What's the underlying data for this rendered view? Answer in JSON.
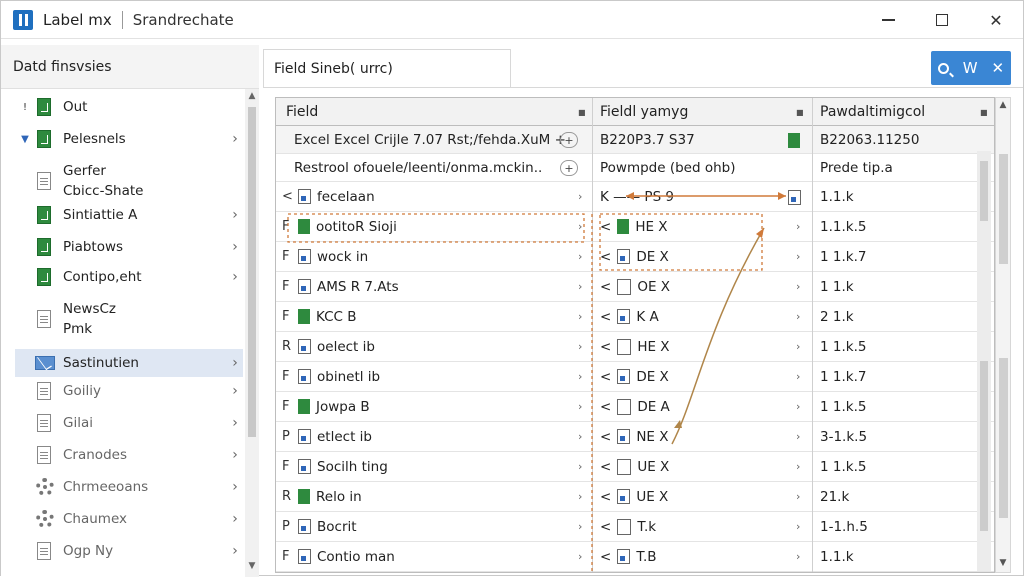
{
  "titlebar": {
    "app_name": "Label mx",
    "doc_name": "Srandrechate",
    "minimize": "—",
    "maximize": "☐",
    "close": "✕"
  },
  "sidebar": {
    "header": "Datd finsvsies",
    "items": [
      {
        "label": "Out",
        "icon": "excel-file-icon",
        "expander": "!"
      },
      {
        "label": "Pelesnels",
        "icon": "excel-file-icon",
        "expander": "▼"
      },
      {
        "label": "Gerfer\nCbicc-Shate",
        "icon": "document-icon",
        "expander": ""
      },
      {
        "label": "Sintiattie A",
        "icon": "excel-file-icon",
        "expander": ""
      },
      {
        "label": "Piabtows",
        "icon": "excel-file-icon",
        "expander": ""
      },
      {
        "label": "Contipo,eht",
        "icon": "excel-file-icon",
        "expander": ""
      },
      {
        "label": "NewsCz\nPmk",
        "icon": "document-icon",
        "expander": ""
      },
      {
        "label": "Sastinutien",
        "icon": "mail-icon",
        "expander": ""
      },
      {
        "label": "Goiliy",
        "icon": "chart-icon",
        "expander": ""
      },
      {
        "label": "Gilai",
        "icon": "puzzle-icon",
        "expander": ""
      },
      {
        "label": "Cranodes",
        "icon": "table-icon",
        "expander": ""
      },
      {
        "label": "Chrmeeoans",
        "icon": "gear-icon",
        "expander": ""
      },
      {
        "label": "Chaumex",
        "icon": "gear-icon",
        "expander": ""
      },
      {
        "label": "Ogp  Ny",
        "icon": "folder-icon",
        "expander": ""
      }
    ],
    "chevron": "›"
  },
  "tab": {
    "label": "Field Sineb( urrc)"
  },
  "search": {
    "letter": "W",
    "close": "✕"
  },
  "grid": {
    "columns": [
      "Field",
      "Fieldl yamyg",
      "Pawdaltimigcol"
    ],
    "rows": [
      {
        "pfx": "",
        "c1": "Excel Excel Crijle 7.07 Rst;/fehda.XuM +",
        "c2": "B220P3.7 S37",
        "c3": "B22063.11250",
        "plus": "+"
      },
      {
        "pfx": "",
        "c1": "Restrool ofouele/leenti/onma.mckin..",
        "c2": "Powmpde (bed ohb)",
        "c3": "Prede tip.a",
        "plus": "+"
      },
      {
        "pfx": "<",
        "c1": "fecelaan",
        "c2": "K  ——  PS 9",
        "c3": "1.1.k"
      },
      {
        "pfx": "F",
        "c1": "ootitoR Sioji",
        "c2": "HE X",
        "c3": "1.1.k.5",
        "lead": "<"
      },
      {
        "pfx": "F",
        "c1": "wock in",
        "c2": "DE X",
        "c3": "1 1.k.7",
        "lead": "<"
      },
      {
        "pfx": "F",
        "c1": "AMS R 7.Ats",
        "c2": "OE X",
        "c3": "1 1.k",
        "lead": "<"
      },
      {
        "pfx": "F",
        "c1": "KCC B",
        "c2": "K A",
        "c3": "2 1.k",
        "lead": "<"
      },
      {
        "pfx": "R",
        "c1": "oelect ib",
        "c2": "HE X",
        "c3": "1 1.k.5",
        "lead": "<"
      },
      {
        "pfx": "F",
        "c1": "obinetl ib",
        "c2": "DE X",
        "c3": "1 1.k.7",
        "lead": "<"
      },
      {
        "pfx": "F",
        "c1": "Jowpa B",
        "c2": "DE A",
        "c3": "1 1.k.5",
        "lead": "<"
      },
      {
        "pfx": "P",
        "c1": "etlect ib",
        "c2": "NE X",
        "c3": "3-1.k.5",
        "lead": "<"
      },
      {
        "pfx": "F",
        "c1": "Socilh ting",
        "c2": "UE X",
        "c3": "1 1.k.5",
        "lead": "<"
      },
      {
        "pfx": "R",
        "c1": "Relo in",
        "c2": "UE X",
        "c3": "21.k",
        "lead": "<"
      },
      {
        "pfx": "P",
        "c1": "Bocrit",
        "c2": "T.k",
        "c3": "1-1.h.5",
        "lead": "<"
      },
      {
        "pfx": "F",
        "c1": "Contio man",
        "c2": "T.B",
        "c3": "1.1.k",
        "lead": "<"
      }
    ],
    "row_arrow": "›"
  },
  "colors": {
    "accent": "#3a86d4",
    "annotation": "#d07a3a",
    "selection": "#dfe7f3",
    "excel_green": "#2e8a3e"
  }
}
